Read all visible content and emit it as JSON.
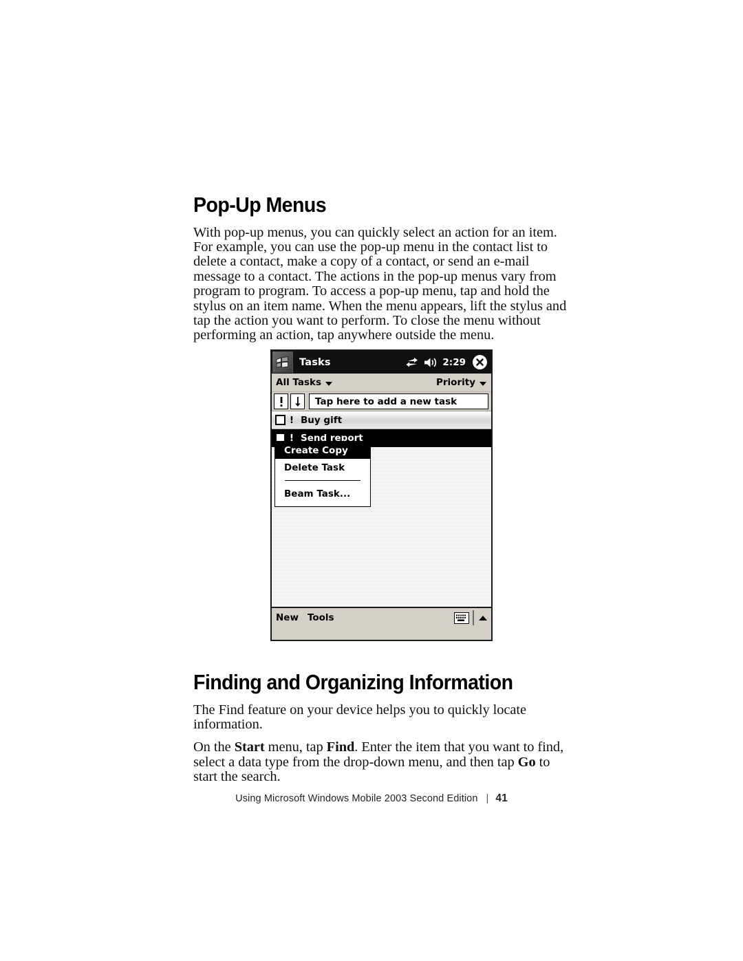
{
  "document": {
    "section1": {
      "heading": "Pop-Up Menus",
      "paragraph": "With pop-up menus, you can quickly select an action for an item. For example, you can use the pop-up menu in the contact list to delete a contact, make a copy of a contact, or send an e-mail message to a contact. The actions in the pop-up menus vary from program to program. To access a pop-up menu, tap and hold the stylus on an item name. When the menu appears, lift the stylus and tap the action you want to perform. To close the menu without performing an action, tap anywhere outside the menu."
    },
    "section2": {
      "heading": "Finding and Organizing Information",
      "paragraph1": "The Find feature on your device helps you to quickly locate information.",
      "paragraph2_parts": {
        "a": "On the ",
        "b_start": "Start",
        "c": " menu, tap ",
        "d_find": "Find",
        "e": ". Enter the item that you want to find, select a data type from the drop-down menu, and then tap ",
        "f_go": "Go",
        "g": " to start the search."
      }
    },
    "footer": {
      "text": "Using Microsoft Windows Mobile 2003 Second Edition",
      "separator": "|",
      "page_number": "41"
    }
  },
  "pda": {
    "titlebar": {
      "app_title": "Tasks",
      "time": "2:29",
      "logo_icon": "windows-flag-icon",
      "connectivity_icon": "sync-arrows-icon",
      "volume_icon": "speaker-icon",
      "close_icon": "close-circle-icon"
    },
    "filterbar": {
      "left_label": "All Tasks",
      "right_label": "Priority",
      "left_icon": "chevron-down-icon",
      "right_icon": "chevron-down-icon"
    },
    "addrow": {
      "priority_button_icon": "exclamation-icon",
      "priority_button_label": "!",
      "sort_button_icon": "arrow-down-icon",
      "sort_button_label": "↓",
      "new_task_placeholder": "Tap here to add a new task"
    },
    "tasks": [
      {
        "label": "Buy gift",
        "priority": "!",
        "checked": false,
        "selected": false
      },
      {
        "label": "Send report",
        "priority": "!",
        "checked": false,
        "selected": true
      }
    ],
    "popup_menu": {
      "items": [
        {
          "label": "Create Copy",
          "highlighted": true
        },
        {
          "label": "Delete Task",
          "highlighted": false
        },
        {
          "label": "Beam Task...",
          "highlighted": false
        }
      ]
    },
    "commandbar": {
      "new_label": "New",
      "tools_label": "Tools",
      "sip_icon": "keyboard-icon",
      "sip_chevron_icon": "chevron-up-icon"
    },
    "colors": {
      "titlebar_bg": "#101010",
      "chrome_bg": "#d4d0c8",
      "selection_bg": "#000000"
    }
  }
}
